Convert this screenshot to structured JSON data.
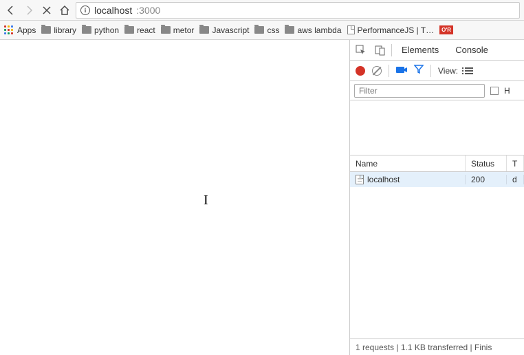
{
  "url": {
    "host": "localhost",
    "port": ":3000"
  },
  "bookmarks": {
    "apps_label": "Apps",
    "items": [
      {
        "label": "library"
      },
      {
        "label": "python"
      },
      {
        "label": "react"
      },
      {
        "label": "metor"
      },
      {
        "label": "Javascript"
      },
      {
        "label": "css"
      },
      {
        "label": "aws lambda"
      }
    ],
    "page_bookmark": "PerformanceJS | T…",
    "badge": "O'R"
  },
  "devtools": {
    "tabs": {
      "elements": "Elements",
      "console": "Console"
    },
    "view_label": "View:",
    "filter_placeholder": "Filter",
    "hide_label": "H",
    "table": {
      "headers": {
        "name": "Name",
        "status": "Status",
        "type": "T"
      },
      "rows": [
        {
          "name": "localhost",
          "status": "200",
          "type": "d"
        }
      ]
    },
    "status_bar": "1 requests | 1.1 KB transferred | Finis"
  }
}
